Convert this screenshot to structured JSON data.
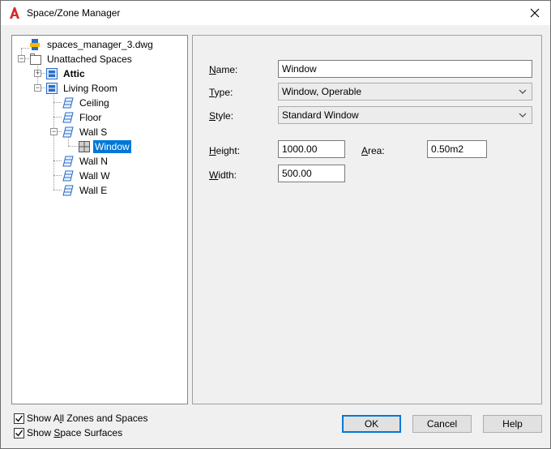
{
  "window": {
    "title": "Space/Zone Manager"
  },
  "tree": {
    "root": "spaces_manager_3.dwg",
    "unattached": "Unattached Spaces",
    "attic": "Attic",
    "living_room": "Living Room",
    "ceiling": "Ceiling",
    "floor": "Floor",
    "wall_s": "Wall S",
    "window": "Window",
    "wall_n": "Wall N",
    "wall_w": "Wall W",
    "wall_e": "Wall E",
    "expander_plus": "+",
    "expander_minus": "−"
  },
  "props": {
    "name_label_u": "N",
    "name_label_rest": "ame:",
    "name_value": "Window",
    "type_label_u": "T",
    "type_label_rest": "ype:",
    "type_value": "Window, Operable",
    "style_label_u": "S",
    "style_label_rest": "tyle:",
    "style_value": "Standard Window",
    "height_label_u": "H",
    "height_label_rest": "eight:",
    "height_value": "1000.00",
    "area_label_u": "A",
    "area_label_rest": "rea:",
    "area_value": "0.50m2",
    "width_label_u": "W",
    "width_label_rest": "idth:",
    "width_value": "500.00"
  },
  "footer": {
    "show_all_pre": "Show A",
    "show_all_u": "l",
    "show_all_post": "l Zones and Spaces",
    "show_surf_pre": "Show ",
    "show_surf_u": "S",
    "show_surf_post": "pace Surfaces",
    "ok": "OK",
    "cancel": "Cancel",
    "help": "Help"
  },
  "colors": {
    "selection": "#0078d7",
    "accent_red": "#d62b2b"
  }
}
